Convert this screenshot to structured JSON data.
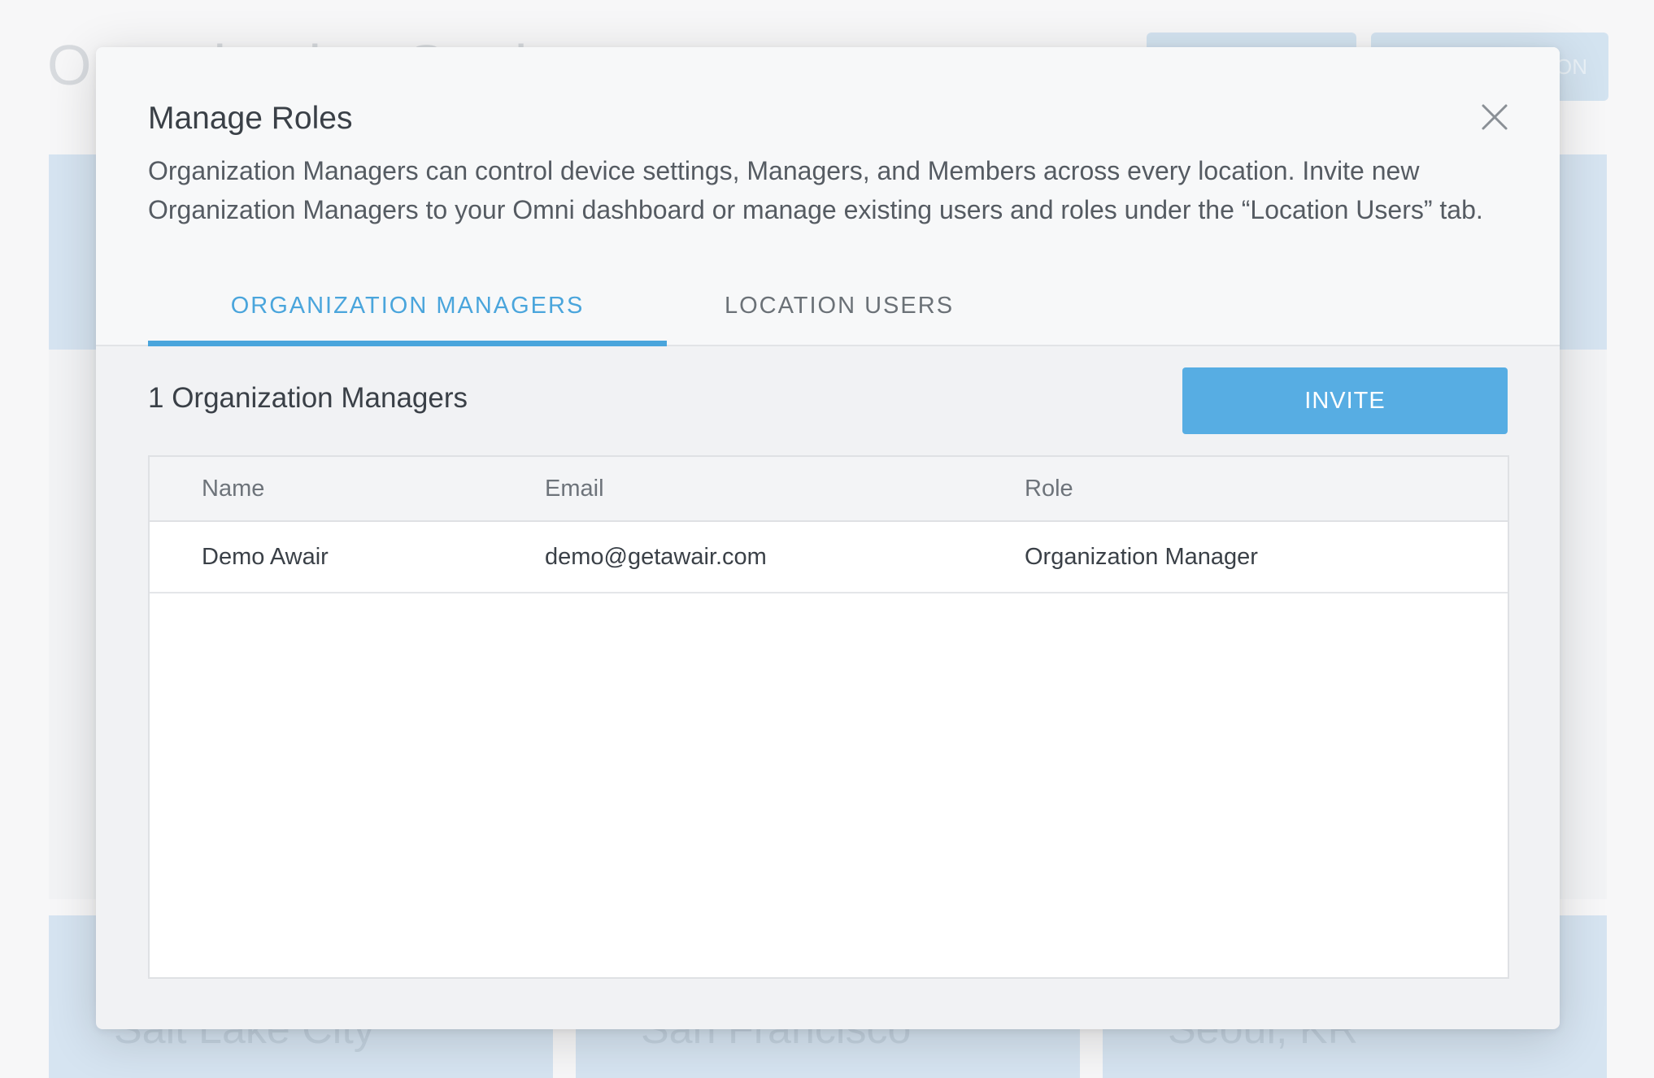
{
  "background": {
    "page_title": "Organization Settings",
    "button_1": "",
    "button_2": "ON",
    "cards": [
      "Salt Lake City",
      "San Francisco",
      "Seoul, KR"
    ]
  },
  "modal": {
    "title": "Manage Roles",
    "description": "Organization Managers can control device settings, Managers, and Members across every location. Invite new Organization Managers to your Omni dashboard or manage existing users and roles under the “Location Users” tab.",
    "close_icon": "close-icon",
    "tabs": [
      {
        "label": "ORGANIZATION MANAGERS",
        "active": true
      },
      {
        "label": "LOCATION USERS",
        "active": false
      }
    ],
    "count_label": "1 Organization Managers",
    "invite_label": "INVITE",
    "table": {
      "columns": [
        "Name",
        "Email",
        "Role"
      ],
      "rows": [
        {
          "name": "Demo Awair",
          "email": "demo@getawair.com",
          "role": "Organization Manager"
        }
      ]
    }
  },
  "colors": {
    "accent": "#4aa5dc",
    "button": "#57ade3"
  }
}
